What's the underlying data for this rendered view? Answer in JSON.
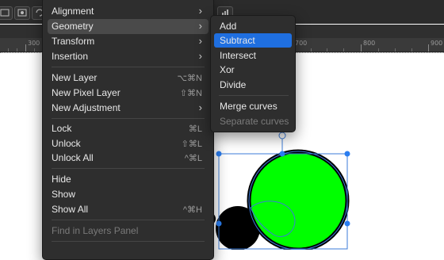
{
  "colors": {
    "menu_bg": "#2e2e2e",
    "highlight": "#4a4a4a",
    "selected": "#1f6fe0",
    "green_shape": "#00ff00",
    "selection_handle": "#2a7df0"
  },
  "ruler": {
    "ticks": [
      "300",
      "700",
      "800",
      "900"
    ]
  },
  "menu": {
    "items": [
      {
        "label": "Alignment",
        "shortcut": "",
        "arrow": "›"
      },
      {
        "label": "Geometry",
        "shortcut": "",
        "arrow": "›"
      },
      {
        "label": "Transform",
        "shortcut": "",
        "arrow": "›"
      },
      {
        "label": "Insertion",
        "shortcut": "",
        "arrow": "›"
      },
      {
        "label": "New Layer",
        "shortcut": "⌥⌘N",
        "arrow": ""
      },
      {
        "label": "New Pixel Layer",
        "shortcut": "⇧⌘N",
        "arrow": ""
      },
      {
        "label": "New Adjustment",
        "shortcut": "",
        "arrow": "›"
      },
      {
        "label": "Lock",
        "shortcut": "⌘L",
        "arrow": ""
      },
      {
        "label": "Unlock",
        "shortcut": "⇧⌘L",
        "arrow": ""
      },
      {
        "label": "Unlock All",
        "shortcut": "^⌘L",
        "arrow": ""
      },
      {
        "label": "Hide",
        "shortcut": "",
        "arrow": ""
      },
      {
        "label": "Show",
        "shortcut": "",
        "arrow": ""
      },
      {
        "label": "Show All",
        "shortcut": "^⌘H",
        "arrow": ""
      },
      {
        "label": "Find in Layers Panel",
        "shortcut": "",
        "arrow": ""
      }
    ]
  },
  "submenu": {
    "items": [
      {
        "label": "Add"
      },
      {
        "label": "Subtract"
      },
      {
        "label": "Intersect"
      },
      {
        "label": "Xor"
      },
      {
        "label": "Divide"
      },
      {
        "label": "Merge curves"
      },
      {
        "label": "Separate curves"
      }
    ]
  }
}
